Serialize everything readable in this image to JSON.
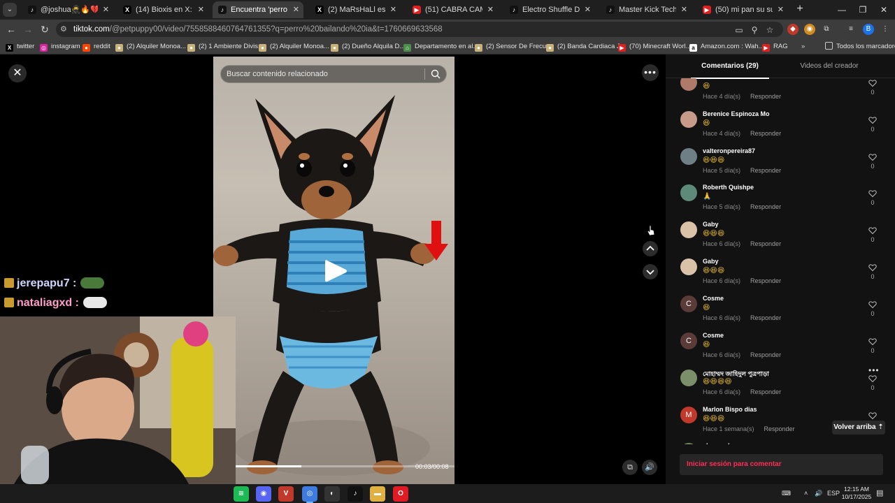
{
  "browser": {
    "tabs": [
      {
        "title": "@joshua🥷🔥💔 #pa",
        "icon": "tiktok-icon",
        "fav_color": "#111111",
        "fav_glyph": "♪",
        "active": false
      },
      {
        "title": "(14) Bioxis en X: \"Scaloni",
        "icon": "x-icon",
        "fav_color": "#000000",
        "fav_glyph": "X",
        "active": false
      },
      {
        "title": "Encuentra 'perro bailando",
        "icon": "tiktok-icon",
        "fav_color": "#111111",
        "fav_glyph": "♪",
        "active": true
      },
      {
        "title": "(2) MaRsHaLl es en X: \"My",
        "icon": "x-icon",
        "fav_color": "#000000",
        "fav_glyph": "X",
        "active": false
      },
      {
        "title": "(51) CABRA CAMINA EN 2",
        "icon": "youtube-icon",
        "fav_color": "#e02020",
        "fav_glyph": "▶",
        "active": false
      },
      {
        "title": "Electro Shuffle Dance Tut",
        "icon": "tiktok-icon",
        "fav_color": "#111111",
        "fav_glyph": "♪",
        "active": false
      },
      {
        "title": "Master Kick Techniques w",
        "icon": "tiktok-icon",
        "fav_color": "#111111",
        "fav_glyph": "♪",
        "active": false
      },
      {
        "title": "(50) mi pan su su sum (c",
        "icon": "youtube-icon",
        "fav_color": "#e02020",
        "fav_glyph": "▶",
        "active": false
      }
    ],
    "url_host": "tiktok.com",
    "url_path": "/@petpuppy00/video/7558588460764761355?q=perro%20bailando%20ia&t=1760669633568",
    "bookmarks": [
      {
        "label": "twitter",
        "icon": "x-icon",
        "color": "#000000",
        "glyph": "X"
      },
      {
        "label": "instagram",
        "icon": "instagram-icon",
        "color": "#d6249f",
        "glyph": "◎"
      },
      {
        "label": "reddit",
        "icon": "reddit-icon",
        "color": "#ff4500",
        "glyph": "●"
      },
      {
        "label": "(2) Alquiler Monoa...",
        "icon": "marketplace-icon",
        "color": "#c9b27a",
        "glyph": "●"
      },
      {
        "label": "(2) 1 Ambiente Divis...",
        "icon": "marketplace-icon",
        "color": "#c9b27a",
        "glyph": "●"
      },
      {
        "label": "(2) Alquiler Monoa...",
        "icon": "marketplace-icon",
        "color": "#c9b27a",
        "glyph": "●"
      },
      {
        "label": "(2) Dueño Alquila D...",
        "icon": "marketplace-icon",
        "color": "#c9b27a",
        "glyph": "●"
      },
      {
        "label": "Departamento en al...",
        "icon": "house-icon",
        "color": "#4a8f4a",
        "glyph": "⌂"
      },
      {
        "label": "(2) Sensor De Frecu...",
        "icon": "marketplace-icon",
        "color": "#c9b27a",
        "glyph": "●"
      },
      {
        "label": "(2) Banda Cardiaca J...",
        "icon": "marketplace-icon",
        "color": "#c9b27a",
        "glyph": "●"
      },
      {
        "label": "(70) Minecraft Worl...",
        "icon": "youtube-icon",
        "color": "#e02020",
        "glyph": "▶"
      },
      {
        "label": "Amazon.com : Wah...",
        "icon": "amazon-icon",
        "color": "#ffffff",
        "glyph": "a"
      },
      {
        "label": "RAG",
        "icon": "youtube-icon",
        "color": "#e02020",
        "glyph": "▶"
      }
    ],
    "all_bookmarks": "Todos los marcadores"
  },
  "video": {
    "search_placeholder": "Buscar contenido relacionado",
    "time": "00:03/00:08",
    "progress": 0.3
  },
  "overlay": {
    "chat": [
      {
        "user": "jerepapu7",
        "sep": ":"
      },
      {
        "user": "nataliagxd",
        "sep": ":"
      }
    ]
  },
  "panel": {
    "tab_comments": "Comentarios (29)",
    "tab_creator": "Videos del creador",
    "comments": [
      {
        "user": "",
        "text": "😆",
        "time": "Hace 4 día(s)",
        "reply": "Responder",
        "likes": "0",
        "avatar_color": "#b07a6a",
        "avatar_letter": ""
      },
      {
        "user": "Berenice Espinoza Mo",
        "text": "😆",
        "time": "Hace 4 día(s)",
        "reply": "Responder",
        "likes": "0",
        "avatar_color": "#c79a8a",
        "avatar_letter": ""
      },
      {
        "user": "valteronpereira87",
        "text": "😆😆😆",
        "time": "Hace 5 día(s)",
        "reply": "Responder",
        "likes": "0",
        "avatar_color": "#6f7f86",
        "avatar_letter": ""
      },
      {
        "user": "Roberth Quishpe",
        "text": "🙏",
        "time": "Hace 5 día(s)",
        "reply": "Responder",
        "likes": "0",
        "avatar_color": "#5e8a7a",
        "avatar_letter": ""
      },
      {
        "user": "Gaby",
        "text": "😆😆😆",
        "time": "Hace 6 día(s)",
        "reply": "Responder",
        "likes": "0",
        "avatar_color": "#d9c2a8",
        "avatar_letter": ""
      },
      {
        "user": "Gaby",
        "text": "😆😆😆",
        "time": "Hace 6 día(s)",
        "reply": "Responder",
        "likes": "0",
        "avatar_color": "#d9c2a8",
        "avatar_letter": ""
      },
      {
        "user": "Cosme",
        "text": "😆",
        "time": "Hace 6 día(s)",
        "reply": "Responder",
        "likes": "0",
        "avatar_color": "#5a3b38",
        "avatar_letter": "C"
      },
      {
        "user": "Cosme",
        "text": "😆",
        "time": "Hace 6 día(s)",
        "reply": "Responder",
        "likes": "0",
        "avatar_color": "#5a3b38",
        "avatar_letter": "C"
      },
      {
        "user": "মোহাম্মদ জাহিদুল পুত্রপাড়া",
        "text": "😆😆😆😆",
        "time": "Hace 6 día(s)",
        "reply": "Responder",
        "likes": "0",
        "avatar_color": "#7a8f6a",
        "avatar_letter": ""
      },
      {
        "user": "Marlon Bispo dias",
        "text": "😆😆😆",
        "time": "Hace 1 semana(s)",
        "reply": "Responder",
        "likes": "0",
        "avatar_color": "#c0392b",
        "avatar_letter": "M"
      },
      {
        "user": "alessandra",
        "text": "😆😆😆",
        "time": "",
        "reply": "",
        "likes": "",
        "avatar_color": "#6f8a5a",
        "avatar_letter": ""
      }
    ],
    "back_to_top": "Volver arriba",
    "login_prompt": "Iniciar sesión para comentar"
  },
  "taskbar": {
    "apps": [
      {
        "icon": "spotify-icon",
        "color": "#1db954",
        "glyph": "≋"
      },
      {
        "icon": "discord-icon",
        "color": "#5865f2",
        "glyph": "◉"
      },
      {
        "icon": "voicemod-icon",
        "color": "#c0392b",
        "glyph": "V"
      },
      {
        "icon": "chrome-icon",
        "color": "#3d7be0",
        "glyph": "◎"
      },
      {
        "icon": "obs-icon",
        "color": "#333333",
        "glyph": "◐"
      },
      {
        "icon": "tiktok-icon",
        "color": "#111111",
        "glyph": "♪"
      },
      {
        "icon": "folder-icon",
        "color": "#e0b040",
        "glyph": "▬"
      },
      {
        "icon": "opera-icon",
        "color": "#e01b24",
        "glyph": "O"
      }
    ],
    "language": "ESP",
    "time": "12:15 AM",
    "date": "10/17/2025"
  }
}
